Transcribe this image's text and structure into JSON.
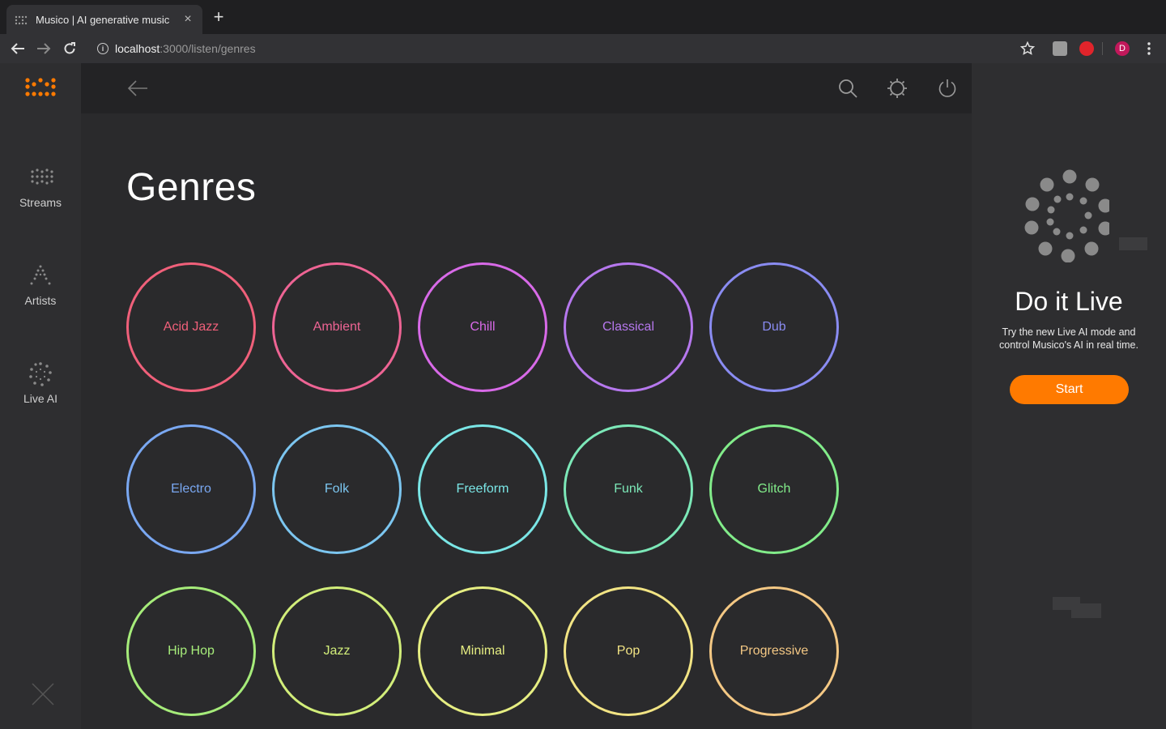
{
  "browser": {
    "tab_title": "Musico | AI generative music",
    "tab_close": "×",
    "new_tab": "+",
    "url_host": "localhost",
    "url_path": ":3000/listen/genres",
    "profile_initial": "D"
  },
  "sidebar": {
    "items": [
      {
        "label": "Streams",
        "icon": "streams-icon"
      },
      {
        "label": "Artists",
        "icon": "artists-icon"
      },
      {
        "label": "Live AI",
        "icon": "live-ai-icon"
      }
    ],
    "accent_color": "#ff7a00"
  },
  "main": {
    "title": "Genres",
    "genres": [
      {
        "label": "Acid Jazz",
        "color": "#f0607a"
      },
      {
        "label": "Ambient",
        "color": "#ee6494"
      },
      {
        "label": "Chill",
        "color": "#d86ae8"
      },
      {
        "label": "Classical",
        "color": "#b678ee"
      },
      {
        "label": "Dub",
        "color": "#8a8cf2"
      },
      {
        "label": "Electro",
        "color": "#7aa8f2"
      },
      {
        "label": "Folk",
        "color": "#7cc6f0"
      },
      {
        "label": "Freeform",
        "color": "#7ae6e6"
      },
      {
        "label": "Funk",
        "color": "#7ce8b8"
      },
      {
        "label": "Glitch",
        "color": "#82ec8a"
      },
      {
        "label": "Hip Hop",
        "color": "#a6ec7a"
      },
      {
        "label": "Jazz",
        "color": "#d2ee7a"
      },
      {
        "label": "Minimal",
        "color": "#e6ee82"
      },
      {
        "label": "Pop",
        "color": "#f2e484"
      },
      {
        "label": "Progressive",
        "color": "#f4c884"
      }
    ]
  },
  "live_panel": {
    "title": "Do it Live",
    "description": "Try the new Live AI mode and control Musico's AI in real time.",
    "start_label": "Start",
    "button_color": "#ff7a00"
  }
}
